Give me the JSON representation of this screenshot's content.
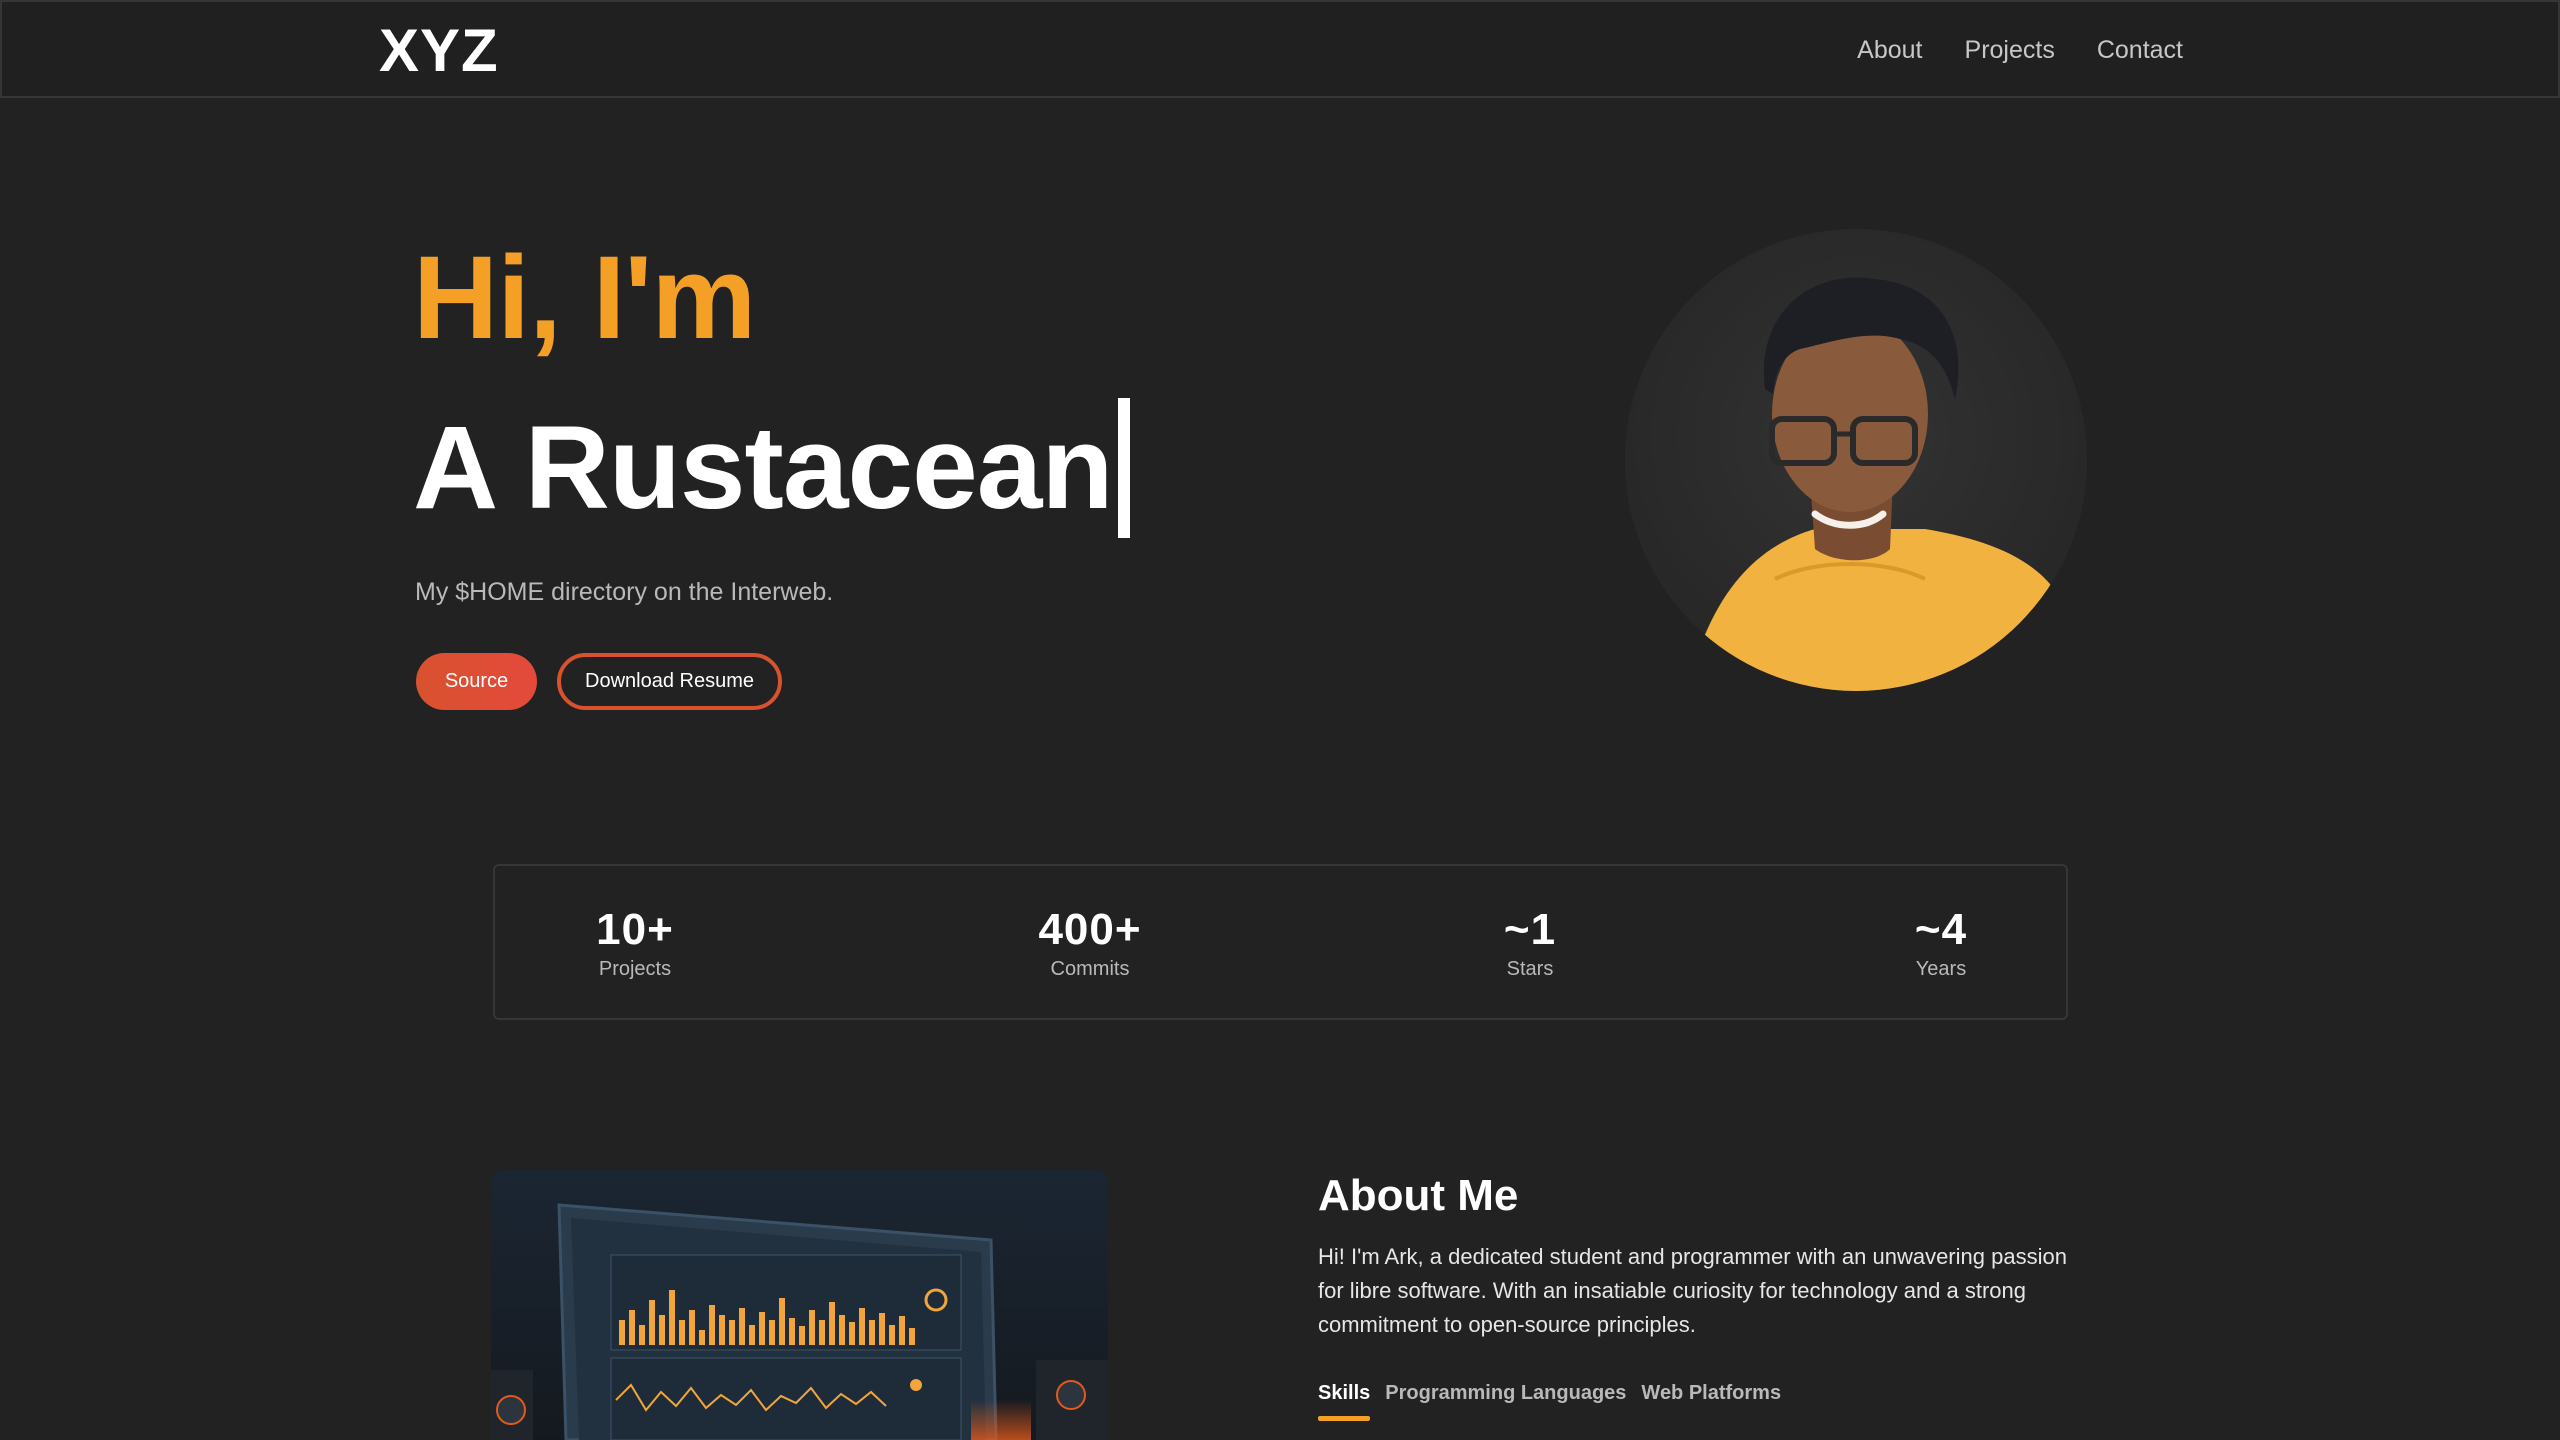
{
  "nav": {
    "logo": "XYZ",
    "links": [
      "About",
      "Projects",
      "Contact"
    ]
  },
  "hero": {
    "greeting": "Hi, I'm",
    "role": "A Rustacean",
    "subtitle": "My $HOME directory on the Interweb.",
    "source_label": "Source",
    "resume_label": "Download Resume"
  },
  "stats": [
    {
      "value": "10+",
      "label": "Projects"
    },
    {
      "value": "400+",
      "label": "Commits"
    },
    {
      "value": "~1",
      "label": "Stars"
    },
    {
      "value": "~4",
      "label": "Years"
    }
  ],
  "about": {
    "title": "About Me",
    "text": "Hi! I'm Ark, a dedicated student and programmer with an unwavering passion for libre software. With an insatiable curiosity for technology and a strong commitment to open-source principles.",
    "tabs": [
      "Skills",
      "Programming Languages",
      "Web Platforms"
    ],
    "active_tab": "Skills"
  },
  "colors": {
    "accent": "#f4a027",
    "button": "#d8522e",
    "background": "#222222"
  }
}
